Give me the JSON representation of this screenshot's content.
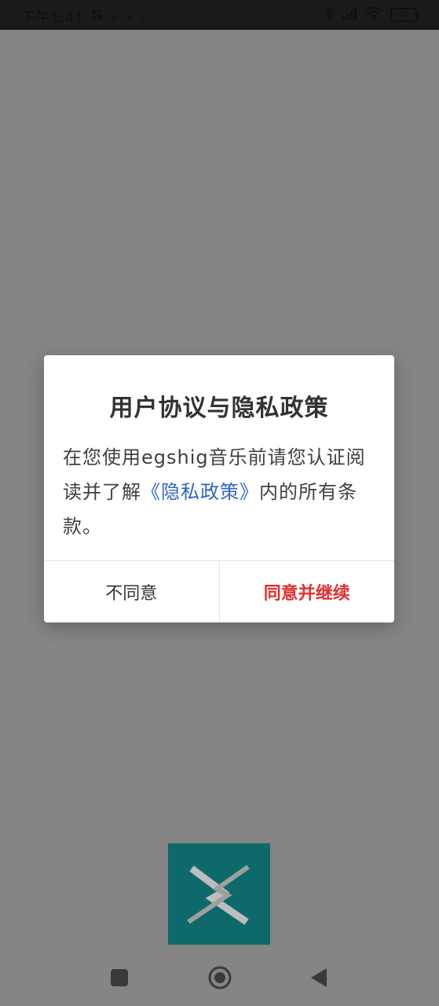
{
  "status_bar": {
    "time": "下午1:41",
    "notification_icons": "✓ ✓ ✓ ··",
    "battery_level": "51"
  },
  "dialog": {
    "title": "用户协议与隐私政策",
    "body_prefix": "在您使用egshig音乐前请您认证阅读并了解",
    "privacy_link": "《隐私政策》",
    "body_suffix": "内的所有条款。",
    "decline_label": "不同意",
    "accept_label": "同意并继续"
  },
  "colors": {
    "overlay": "#858585",
    "link": "#2d64c8",
    "accept": "#e52e2e",
    "logo_bg": "#0e6a6a"
  },
  "nav_bar": {
    "icons": [
      "recents-icon",
      "home-icon",
      "back-icon"
    ]
  }
}
